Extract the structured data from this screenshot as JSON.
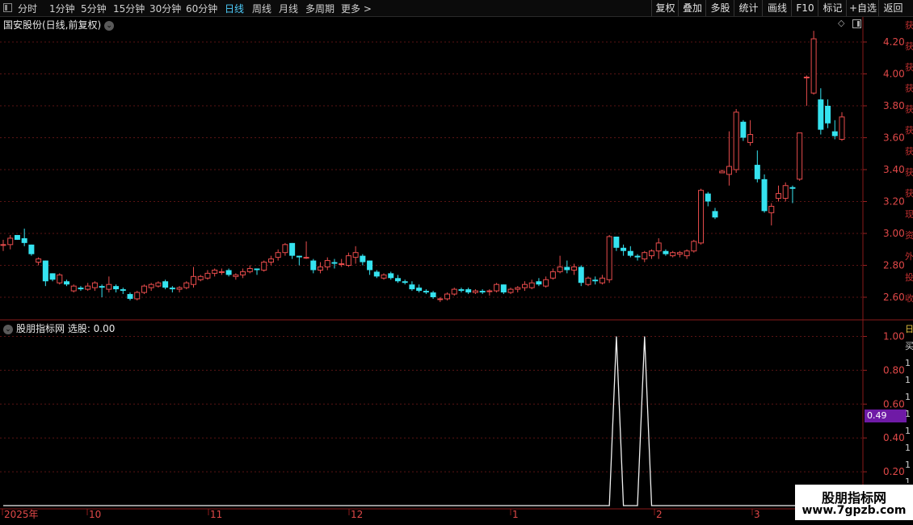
{
  "toolbar": {
    "timeframes": [
      "分时",
      "1分钟",
      "5分钟",
      "15分钟",
      "30分钟",
      "60分钟",
      "日线",
      "周线",
      "月线",
      "多周期",
      "更多 >"
    ],
    "active": "日线",
    "buttons": [
      "复权",
      "叠加",
      "多股",
      "统计",
      "画线",
      "F10",
      "标记",
      "+自选",
      "返回"
    ]
  },
  "main": {
    "title": "国安股份(日线,前复权)",
    "y_ticks": [
      "4.20",
      "4.00",
      "3.80",
      "3.60",
      "3.40",
      "3.20",
      "3.00",
      "2.80",
      "2.60"
    ]
  },
  "indicator": {
    "title": "股朋指标网 选股: 0.00",
    "y_ticks": [
      "1.00",
      "0.80",
      "0.60",
      "0.40",
      "0.20"
    ],
    "value_badge": "0.49"
  },
  "x_labels": [
    "2025年",
    "10",
    "11",
    "12",
    "1",
    "2",
    "3"
  ],
  "watermark": {
    "line1": "股朋指标网",
    "line2": "www.7gpzb.com"
  },
  "side_chars": [
    "获",
    "获",
    "获",
    "获",
    "获",
    "获",
    "获",
    "获",
    "获",
    "现",
    "资",
    "外",
    "投",
    "收"
  ],
  "side_chars2": [
    "日",
    "买",
    "1",
    "1",
    "1",
    "1",
    "1",
    "1",
    "1",
    "1"
  ],
  "colors": {
    "up": "#e84c4c",
    "down": "#35e3f0",
    "accent": "#4ecdfc",
    "badge": "#6f1aa6"
  },
  "chart_data": {
    "type": "candlestick",
    "ylim": [
      2.55,
      4.3
    ],
    "candles": [
      [
        2.93,
        2.96,
        2.89,
        2.93
      ],
      [
        2.93,
        2.99,
        2.9,
        2.97
      ],
      [
        2.99,
        2.99,
        2.96,
        2.96
      ],
      [
        2.97,
        3.03,
        2.92,
        2.94
      ],
      [
        2.93,
        2.93,
        2.86,
        2.87
      ],
      [
        2.82,
        2.85,
        2.8,
        2.84
      ],
      [
        2.83,
        2.83,
        2.67,
        2.7
      ],
      [
        2.75,
        2.75,
        2.7,
        2.71
      ],
      [
        2.69,
        2.75,
        2.68,
        2.74
      ],
      [
        2.7,
        2.71,
        2.67,
        2.68
      ],
      [
        2.64,
        2.68,
        2.63,
        2.67
      ],
      [
        2.66,
        2.67,
        2.64,
        2.65
      ],
      [
        2.65,
        2.69,
        2.64,
        2.67
      ],
      [
        2.66,
        2.7,
        2.64,
        2.69
      ],
      [
        2.67,
        2.68,
        2.6,
        2.66
      ],
      [
        2.65,
        2.73,
        2.63,
        2.68
      ],
      [
        2.67,
        2.68,
        2.63,
        2.65
      ],
      [
        2.65,
        2.66,
        2.62,
        2.64
      ],
      [
        2.62,
        2.63,
        2.58,
        2.59
      ],
      [
        2.59,
        2.64,
        2.58,
        2.63
      ],
      [
        2.63,
        2.68,
        2.62,
        2.67
      ],
      [
        2.66,
        2.69,
        2.64,
        2.68
      ],
      [
        2.67,
        2.7,
        2.66,
        2.69
      ],
      [
        2.7,
        2.71,
        2.65,
        2.66
      ],
      [
        2.66,
        2.67,
        2.63,
        2.65
      ],
      [
        2.65,
        2.67,
        2.63,
        2.66
      ],
      [
        2.66,
        2.7,
        2.65,
        2.69
      ],
      [
        2.68,
        2.79,
        2.66,
        2.73
      ],
      [
        2.71,
        2.74,
        2.7,
        2.73
      ],
      [
        2.72,
        2.77,
        2.71,
        2.75
      ],
      [
        2.75,
        2.78,
        2.73,
        2.77
      ],
      [
        2.76,
        2.78,
        2.74,
        2.76
      ],
      [
        2.77,
        2.78,
        2.73,
        2.74
      ],
      [
        2.73,
        2.75,
        2.71,
        2.74
      ],
      [
        2.74,
        2.78,
        2.72,
        2.76
      ],
      [
        2.76,
        2.8,
        2.75,
        2.78
      ],
      [
        2.78,
        2.78,
        2.74,
        2.77
      ],
      [
        2.77,
        2.83,
        2.76,
        2.82
      ],
      [
        2.82,
        2.86,
        2.8,
        2.84
      ],
      [
        2.85,
        2.9,
        2.83,
        2.88
      ],
      [
        2.88,
        2.94,
        2.86,
        2.93
      ],
      [
        2.94,
        2.94,
        2.84,
        2.86
      ],
      [
        2.86,
        2.86,
        2.8,
        2.85
      ],
      [
        2.85,
        2.95,
        2.84,
        2.85
      ],
      [
        2.83,
        2.84,
        2.75,
        2.77
      ],
      [
        2.77,
        2.82,
        2.75,
        2.79
      ],
      [
        2.79,
        2.85,
        2.77,
        2.83
      ],
      [
        2.82,
        2.84,
        2.78,
        2.81
      ],
      [
        2.81,
        2.84,
        2.79,
        2.81
      ],
      [
        2.8,
        2.88,
        2.79,
        2.86
      ],
      [
        2.85,
        2.92,
        2.81,
        2.88
      ],
      [
        2.86,
        2.87,
        2.8,
        2.82
      ],
      [
        2.83,
        2.83,
        2.74,
        2.77
      ],
      [
        2.76,
        2.77,
        2.72,
        2.73
      ],
      [
        2.72,
        2.75,
        2.71,
        2.74
      ],
      [
        2.75,
        2.76,
        2.71,
        2.72
      ],
      [
        2.72,
        2.74,
        2.69,
        2.7
      ],
      [
        2.7,
        2.71,
        2.68,
        2.69
      ],
      [
        2.68,
        2.7,
        2.64,
        2.65
      ],
      [
        2.66,
        2.68,
        2.63,
        2.64
      ],
      [
        2.64,
        2.65,
        2.62,
        2.63
      ],
      [
        2.63,
        2.64,
        2.59,
        2.6
      ],
      [
        2.59,
        2.6,
        2.57,
        2.59
      ],
      [
        2.59,
        2.63,
        2.58,
        2.62
      ],
      [
        2.62,
        2.66,
        2.61,
        2.65
      ],
      [
        2.65,
        2.66,
        2.63,
        2.64
      ],
      [
        2.65,
        2.66,
        2.62,
        2.63
      ],
      [
        2.63,
        2.65,
        2.62,
        2.64
      ],
      [
        2.64,
        2.65,
        2.62,
        2.63
      ],
      [
        2.64,
        2.65,
        2.61,
        2.64
      ],
      [
        2.64,
        2.69,
        2.63,
        2.68
      ],
      [
        2.68,
        2.68,
        2.62,
        2.63
      ],
      [
        2.63,
        2.66,
        2.62,
        2.65
      ],
      [
        2.65,
        2.67,
        2.63,
        2.66
      ],
      [
        2.66,
        2.7,
        2.64,
        2.68
      ],
      [
        2.66,
        2.71,
        2.65,
        2.69
      ],
      [
        2.7,
        2.72,
        2.67,
        2.68
      ],
      [
        2.67,
        2.73,
        2.66,
        2.71
      ],
      [
        2.72,
        2.78,
        2.71,
        2.76
      ],
      [
        2.76,
        2.86,
        2.75,
        2.79
      ],
      [
        2.79,
        2.83,
        2.75,
        2.77
      ],
      [
        2.77,
        2.81,
        2.74,
        2.79
      ],
      [
        2.79,
        2.8,
        2.67,
        2.69
      ],
      [
        2.68,
        2.73,
        2.67,
        2.72
      ],
      [
        2.71,
        2.73,
        2.68,
        2.7
      ],
      [
        2.69,
        2.74,
        2.68,
        2.72
      ],
      [
        2.71,
        2.99,
        2.69,
        2.98
      ],
      [
        2.98,
        2.98,
        2.89,
        2.91
      ],
      [
        2.91,
        2.93,
        2.86,
        2.89
      ],
      [
        2.89,
        2.92,
        2.85,
        2.86
      ],
      [
        2.86,
        2.87,
        2.83,
        2.85
      ],
      [
        2.84,
        2.89,
        2.82,
        2.88
      ],
      [
        2.86,
        2.9,
        2.84,
        2.89
      ],
      [
        2.89,
        2.97,
        2.84,
        2.94
      ],
      [
        2.89,
        2.9,
        2.86,
        2.87
      ],
      [
        2.86,
        2.89,
        2.85,
        2.88
      ],
      [
        2.87,
        2.89,
        2.85,
        2.88
      ],
      [
        2.86,
        2.9,
        2.84,
        2.89
      ],
      [
        2.89,
        2.96,
        2.88,
        2.95
      ],
      [
        2.94,
        3.28,
        2.93,
        3.27
      ],
      [
        3.25,
        3.26,
        3.17,
        3.2
      ],
      [
        3.14,
        3.16,
        3.09,
        3.1
      ],
      [
        3.38,
        3.4,
        3.38,
        3.39
      ],
      [
        3.37,
        3.64,
        3.3,
        3.42
      ],
      [
        3.4,
        3.78,
        3.38,
        3.76
      ],
      [
        3.7,
        3.71,
        3.58,
        3.6
      ],
      [
        3.57,
        3.71,
        3.55,
        3.62
      ],
      [
        3.43,
        3.52,
        3.32,
        3.34
      ],
      [
        3.34,
        3.37,
        3.13,
        3.14
      ],
      [
        3.13,
        3.19,
        3.05,
        3.17
      ],
      [
        3.22,
        3.3,
        3.2,
        3.25
      ],
      [
        3.22,
        3.32,
        3.2,
        3.3
      ],
      [
        3.29,
        3.3,
        3.19,
        3.28
      ],
      [
        3.34,
        3.63,
        3.33,
        3.63
      ],
      [
        3.98,
        3.99,
        3.8,
        3.98
      ],
      [
        3.88,
        4.27,
        3.87,
        4.22
      ],
      [
        3.84,
        3.91,
        3.62,
        3.65
      ],
      [
        3.8,
        3.84,
        3.66,
        3.69
      ],
      [
        3.64,
        3.71,
        3.59,
        3.61
      ],
      [
        3.59,
        3.76,
        3.58,
        3.73
      ]
    ],
    "indicator_spikes": [
      {
        "index": 87,
        "value": 1.0
      },
      {
        "index": 91,
        "value": 1.0
      }
    ]
  }
}
